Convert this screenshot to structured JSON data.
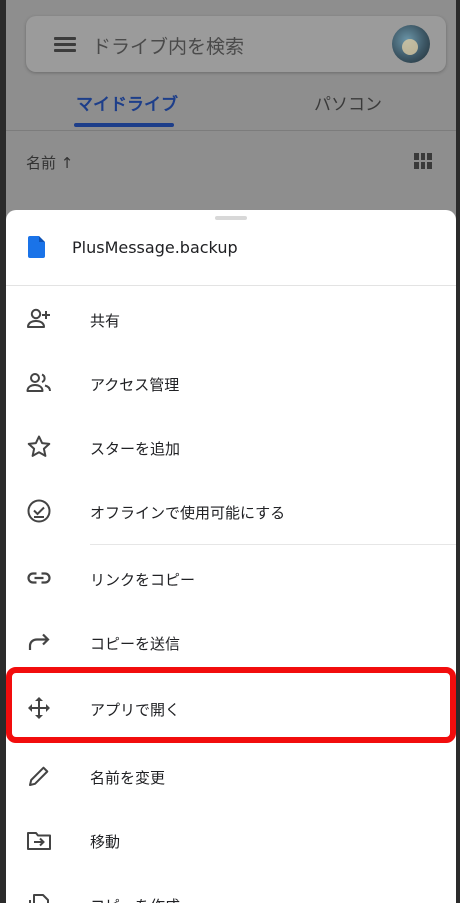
{
  "search": {
    "placeholder": "ドライブ内を検索"
  },
  "tabs": [
    {
      "label": "マイドライブ",
      "active": true
    },
    {
      "label": "パソコン",
      "active": false
    }
  ],
  "sort": {
    "label": "名前 ↑"
  },
  "sheet": {
    "file_name": "PlusMessage.backup",
    "items": [
      {
        "label": "共有",
        "icon": "person-add-icon"
      },
      {
        "label": "アクセス管理",
        "icon": "people-icon"
      },
      {
        "label": "スターを追加",
        "icon": "star-outline-icon"
      },
      {
        "label": "オフラインで使用可能にする",
        "icon": "offline-check-icon"
      },
      {
        "label": "リンクをコピー",
        "icon": "link-icon"
      },
      {
        "label": "コピーを送信",
        "icon": "share-arrow-icon"
      },
      {
        "label": "アプリで開く",
        "icon": "open-with-move-icon",
        "highlighted": true
      },
      {
        "label": "名前を変更",
        "icon": "pencil-icon"
      },
      {
        "label": "移動",
        "icon": "folder-move-icon"
      },
      {
        "label": "コピーを作成",
        "icon": "copy-icon"
      }
    ]
  },
  "colors": {
    "accent": "#1d3e8a",
    "highlight": "#f20d0d",
    "file_icon": "#1a73e8"
  }
}
